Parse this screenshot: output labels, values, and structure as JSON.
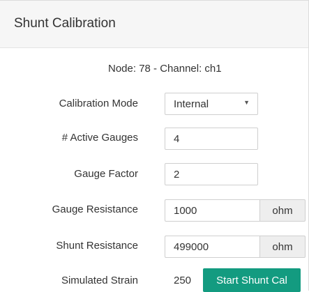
{
  "panel": {
    "title": "Shunt Calibration"
  },
  "node_channel": "Node: 78 - Channel: ch1",
  "fields": {
    "calibration_mode": {
      "label": "Calibration Mode",
      "value": "Internal"
    },
    "active_gauges": {
      "label": "# Active Gauges",
      "value": "4"
    },
    "gauge_factor": {
      "label": "Gauge Factor",
      "value": "2"
    },
    "gauge_resistance": {
      "label": "Gauge Resistance",
      "value": "1000",
      "unit": "ohm"
    },
    "shunt_resistance": {
      "label": "Shunt Resistance",
      "value": "499000",
      "unit": "ohm"
    },
    "simulated_strain": {
      "label": "Simulated Strain",
      "value": "250"
    }
  },
  "actions": {
    "start_label": "Start Shunt Cal"
  },
  "colors": {
    "accent": "#139b80",
    "header_bg": "#f6f6f6"
  },
  "icons": {
    "dropdown": "caret-down-icon"
  }
}
